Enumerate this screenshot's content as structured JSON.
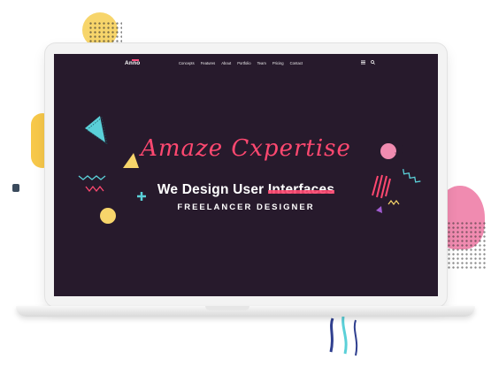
{
  "nav": {
    "logo": "Anno",
    "items": [
      "Concepts",
      "Features",
      "About",
      "Portfolio",
      "Team",
      "Pricing",
      "Contact"
    ],
    "icons": [
      "menu-icon",
      "search-icon"
    ]
  },
  "hero": {
    "script_title": "Amaze Cxpertise",
    "headline_prefix": "We Design User ",
    "headline_highlight": "Interfaces",
    "subheadline": "FREELANCER DESIGNER"
  },
  "colors": {
    "screen_bg": "#271a2c",
    "accent_pink": "#ff4870",
    "teal": "#5ad0d8",
    "yellow": "#f7d56b",
    "magenta": "#f08bb0"
  }
}
